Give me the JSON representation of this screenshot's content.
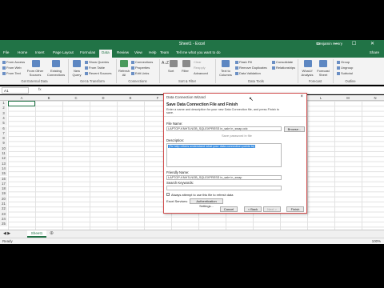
{
  "window": {
    "title": "Sheet1 - Excel",
    "user": "Benjamin Henry",
    "controls": "▭ ─ ☐ ✕"
  },
  "tabs": [
    "File",
    "Home",
    "Insert",
    "Page Layout",
    "Formulas",
    "Data",
    "Review",
    "View",
    "Help",
    "Team"
  ],
  "tell_me": "Tell me what you want to do",
  "share": "Share",
  "ribbon": {
    "get_external": {
      "items": [
        "From Access",
        "From Web",
        "From Text",
        "From Other Sources",
        "Existing Connections"
      ],
      "group": "Get External Data"
    },
    "get_transform": {
      "items": [
        "New Query",
        "Show Queries",
        "From Table",
        "Recent Sources"
      ],
      "group": "Get & Transform"
    },
    "connections": {
      "items": [
        "Refresh All",
        "Connections",
        "Properties",
        "Edit Links"
      ],
      "group": "Connections"
    },
    "sort_filter": {
      "items": [
        "Sort",
        "Filter",
        "Clear",
        "Reapply",
        "Advanced"
      ],
      "group": "Sort & Filter"
    },
    "data_tools": {
      "items": [
        "Text to Columns",
        "Flash Fill",
        "Remove Duplicates",
        "Data Validation",
        "Consolidate",
        "Relationships"
      ],
      "group": "Data Tools"
    },
    "forecast": {
      "items": [
        "What-If Analysis",
        "Forecast Sheet"
      ],
      "group": "Forecast"
    },
    "outline": {
      "items": [
        "Group",
        "Ungroup",
        "Subtotal"
      ],
      "group": "Outline"
    }
  },
  "formula_bar": {
    "namebox": "A1",
    "fx": "fx"
  },
  "columns": [
    "A",
    "B",
    "C",
    "D",
    "E",
    "F",
    "G",
    "H",
    "I",
    "J",
    "K",
    "L",
    "M",
    "N"
  ],
  "rows": [
    "1",
    "2",
    "3",
    "4",
    "5",
    "6",
    "7",
    "8",
    "9",
    "10",
    "11",
    "12",
    "13",
    "14",
    "15",
    "16",
    "17",
    "18",
    "19",
    "20",
    "21",
    "22",
    "23",
    "24",
    "25"
  ],
  "sheet_tab": "Sheet1",
  "status": {
    "ready": "Ready",
    "zoom": "100%"
  },
  "dialog": {
    "title": "Data Connection Wizard",
    "heading": "Save Data Connection File and Finish",
    "subheading": "Enter a name and description for your new Data Connection file, and press Finish to save.",
    "file_name_label": "File Name:",
    "file_name_value": "LAPTOP-KNH7LNOB_SQLEXPRESS in_sale in_swap.odc",
    "browse": "Browse...",
    "save_password": "Save password in file",
    "description_label": "Description:",
    "description_value": "(To help others understand what your data connection points to)",
    "friendly_label": "Friendly Name:",
    "friendly_value": "LAPTOP-KNH7LNOB_SQLEXPRESS in_sale in_swap",
    "keywords_label": "Search Keywords:",
    "always_attempt": "Always attempt to use this file to refresh data",
    "excel_services": "Excel Services:",
    "auth_settings": "Authentication Settings...",
    "cancel": "Cancel",
    "back": "< Back",
    "next": "Next >",
    "finish": "Finish"
  }
}
